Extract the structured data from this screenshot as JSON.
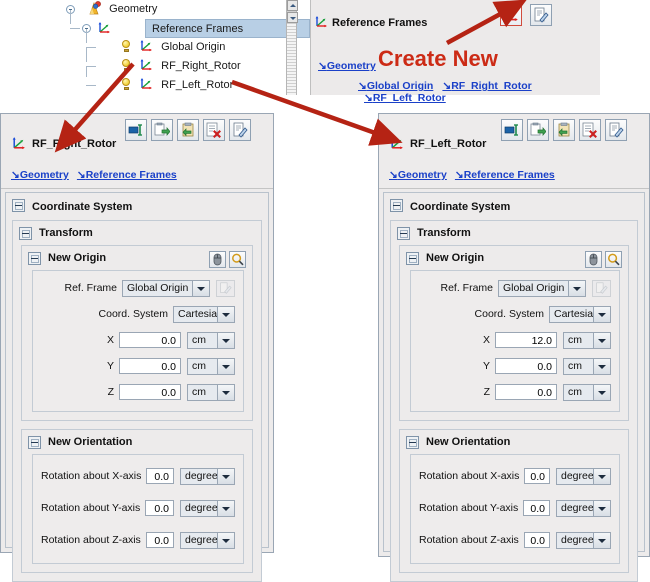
{
  "tree": {
    "items": [
      {
        "label": "Geometry",
        "icon": "geometry-icon",
        "depth": 0,
        "selected": false,
        "bulb": false
      },
      {
        "label": "Reference Frames",
        "icon": "coordinate-frame-icon",
        "depth": 1,
        "selected": true,
        "bulb": false
      },
      {
        "label": "Global Origin",
        "icon": "coordinate-frame-icon",
        "depth": 2,
        "selected": false,
        "bulb": true
      },
      {
        "label": "RF_Right_Rotor",
        "icon": "coordinate-frame-icon",
        "depth": 2,
        "selected": false,
        "bulb": true
      },
      {
        "label": "RF_Left_Rotor",
        "icon": "coordinate-frame-icon",
        "depth": 2,
        "selected": false,
        "bulb": true
      }
    ]
  },
  "summary": {
    "title": "Reference Frames",
    "title_icon": "coordinate-frame-icon",
    "buttons": [
      {
        "name": "create-new-reference-frame-button",
        "icon": "coordinate-frame-icon",
        "selected": true
      },
      {
        "name": "edit-properties-button",
        "icon": "edit-document-icon",
        "selected": false
      }
    ],
    "breadcrumb": [
      {
        "label": "Geometry",
        "arrow": "↘"
      }
    ],
    "child_links": [
      {
        "label": "Global Origin",
        "arrow": "↘"
      },
      {
        "label": "RF_Right_Rotor",
        "arrow": "↘"
      },
      {
        "label": "RF_Left_Rotor",
        "arrow": "↘"
      }
    ]
  },
  "annotation": {
    "create_new_label": "Create New",
    "accent_color": "#cc2b16"
  },
  "left_editor": {
    "title": "RF_Right_Rotor",
    "title_icon": "coordinate-frame-icon",
    "toolbar": [
      {
        "name": "rename-button",
        "icon": "rename-icon"
      },
      {
        "name": "copy-out-button",
        "icon": "copy-out-icon"
      },
      {
        "name": "paste-in-button",
        "icon": "paste-in-icon"
      },
      {
        "name": "delete-button",
        "icon": "delete-icon"
      },
      {
        "name": "edit-button",
        "icon": "edit-document-icon"
      }
    ],
    "breadcrumb": [
      {
        "label": "Geometry",
        "arrow": "↘"
      },
      {
        "label": "Reference Frames",
        "arrow": "↘"
      }
    ],
    "coordinate_system": {
      "title": "Coordinate System",
      "transform": {
        "title": "Transform",
        "new_origin": {
          "title": "New Origin",
          "buttons": [
            {
              "name": "pick-with-mouse-button",
              "icon": "mouse-icon"
            },
            {
              "name": "zoom-search-button",
              "icon": "magnifier-icon"
            }
          ],
          "ref_frame_label": "Ref. Frame",
          "ref_frame_value": "Global Origin",
          "ref_frame_edit": {
            "name": "ref-frame-edit-button",
            "icon": "edit-document-icon",
            "disabled": true
          },
          "coord_system_label": "Coord. System",
          "coord_system_value": "Cartesian",
          "axes": [
            {
              "label": "X",
              "value": "0.0",
              "unit": "cm"
            },
            {
              "label": "Y",
              "value": "0.0",
              "unit": "cm"
            },
            {
              "label": "Z",
              "value": "0.0",
              "unit": "cm"
            }
          ]
        },
        "new_orientation": {
          "title": "New Orientation",
          "rotations": [
            {
              "label": "Rotation about X-axis",
              "value": "0.0",
              "unit": "degrees"
            },
            {
              "label": "Rotation about Y-axis",
              "value": "0.0",
              "unit": "degrees"
            },
            {
              "label": "Rotation about Z-axis",
              "value": "0.0",
              "unit": "degrees"
            }
          ]
        }
      }
    }
  },
  "right_editor": {
    "title": "RF_Left_Rotor",
    "title_icon": "coordinate-frame-icon",
    "toolbar": [
      {
        "name": "rename-button",
        "icon": "rename-icon"
      },
      {
        "name": "copy-out-button",
        "icon": "copy-out-icon"
      },
      {
        "name": "paste-in-button",
        "icon": "paste-in-icon"
      },
      {
        "name": "delete-button",
        "icon": "delete-icon"
      },
      {
        "name": "edit-button",
        "icon": "edit-document-icon"
      }
    ],
    "breadcrumb": [
      {
        "label": "Geometry",
        "arrow": "↘"
      },
      {
        "label": "Reference Frames",
        "arrow": "↘"
      }
    ],
    "coordinate_system": {
      "title": "Coordinate System",
      "transform": {
        "title": "Transform",
        "new_origin": {
          "title": "New Origin",
          "buttons": [
            {
              "name": "pick-with-mouse-button",
              "icon": "mouse-icon"
            },
            {
              "name": "zoom-search-button",
              "icon": "magnifier-icon"
            }
          ],
          "ref_frame_label": "Ref. Frame",
          "ref_frame_value": "Global Origin",
          "ref_frame_edit": {
            "name": "ref-frame-edit-button",
            "icon": "edit-document-icon",
            "disabled": true
          },
          "coord_system_label": "Coord. System",
          "coord_system_value": "Cartesian",
          "axes": [
            {
              "label": "X",
              "value": "12.0",
              "unit": "cm"
            },
            {
              "label": "Y",
              "value": "0.0",
              "unit": "cm"
            },
            {
              "label": "Z",
              "value": "0.0",
              "unit": "cm"
            }
          ]
        },
        "new_orientation": {
          "title": "New Orientation",
          "rotations": [
            {
              "label": "Rotation about X-axis",
              "value": "0.0",
              "unit": "degrees"
            },
            {
              "label": "Rotation about Y-axis",
              "value": "0.0",
              "unit": "degrees"
            },
            {
              "label": "Rotation about Z-axis",
              "value": "0.0",
              "unit": "degrees"
            }
          ]
        }
      }
    }
  }
}
